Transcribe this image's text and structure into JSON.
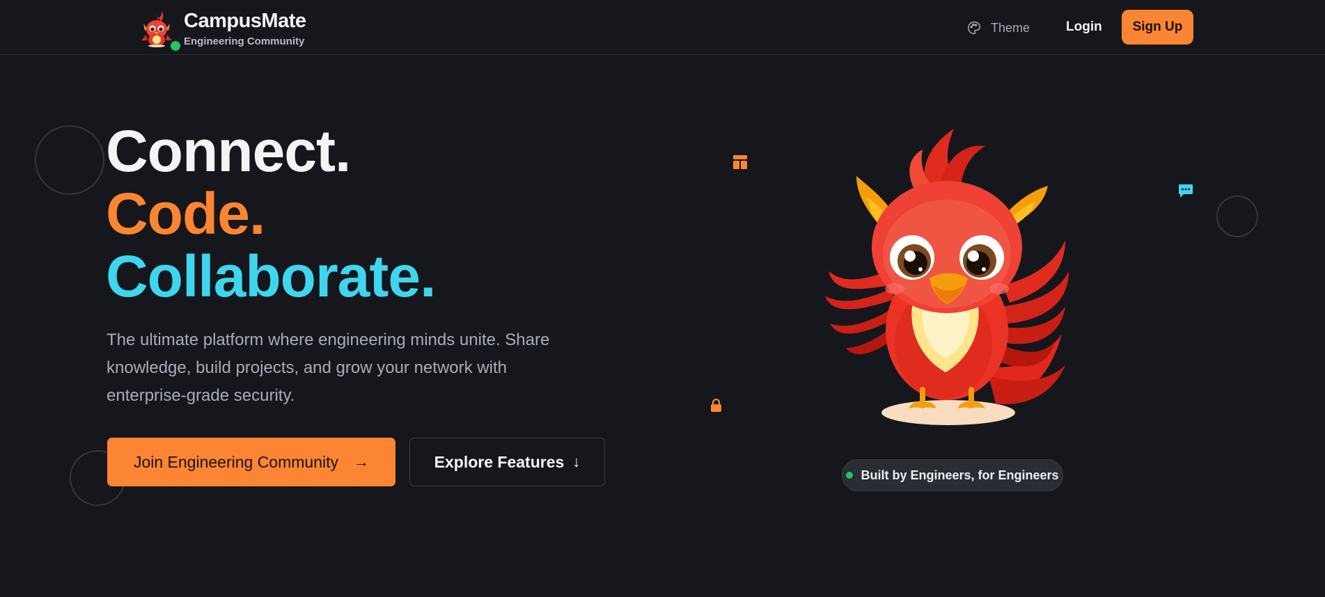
{
  "header": {
    "brand_name": "CampusMate",
    "brand_subtitle": "Engineering Community",
    "online_status_color": "#22c55e",
    "theme_label": "Theme",
    "theme_icon": "palette-icon",
    "login_label": "Login",
    "signup_label": "Sign Up"
  },
  "hero": {
    "headline": [
      "Connect.",
      "Code.",
      "Collaborate."
    ],
    "headline_colors": [
      "#f4f4f5",
      "#fb8532",
      "#3ed6ee"
    ],
    "description": "The ultimate platform where engineering minds unite. Share knowledge, build projects, and grow your network with enterprise-grade security.",
    "primary_cta": "Join Engineering Community",
    "primary_cta_icon": "arrow-right-icon",
    "secondary_cta": "Explore Features",
    "secondary_cta_icon": "arrow-down-icon"
  },
  "floating_icons": [
    "layout-icon",
    "chat-icon",
    "lock-icon"
  ],
  "badge": {
    "label": "Built by Engineers, for Engineers",
    "dot_color": "#22c55e"
  },
  "colors": {
    "background": "#16171d",
    "accent_orange": "#fb8532",
    "accent_cyan": "#3ed6ee"
  }
}
